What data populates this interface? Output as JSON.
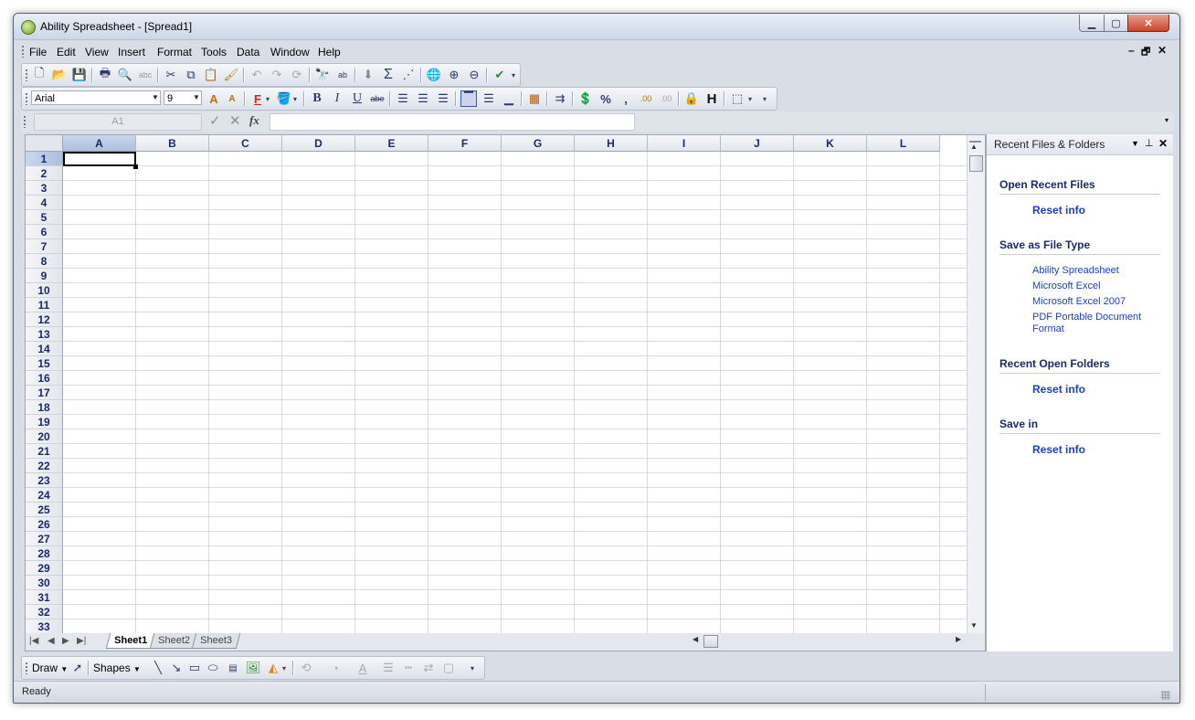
{
  "window": {
    "title": "Ability Spreadsheet - [Spread1]",
    "min_glyph": "▁",
    "max_glyph": "▢",
    "close_glyph": "✕"
  },
  "menubar": {
    "items": [
      "File",
      "Edit",
      "View",
      "Insert",
      "Format",
      "Tools",
      "Data",
      "Window",
      "Help"
    ],
    "mdi_min": "–",
    "mdi_restore": "🗗",
    "mdi_close": "✕"
  },
  "format_toolbar": {
    "font": "Arial",
    "size": "9"
  },
  "formula_bar": {
    "cell_ref": "A1",
    "formula": "",
    "fx_label": "fx"
  },
  "grid": {
    "columns": [
      "A",
      "B",
      "C",
      "D",
      "E",
      "F",
      "G",
      "H",
      "I",
      "J",
      "K",
      "L"
    ],
    "rows": [
      "1",
      "2",
      "3",
      "4",
      "5",
      "6",
      "7",
      "8",
      "9",
      "10",
      "11",
      "12",
      "13",
      "14",
      "15",
      "16",
      "17",
      "18",
      "19",
      "20",
      "21",
      "22",
      "23",
      "24",
      "25",
      "26",
      "27",
      "28",
      "29",
      "30",
      "31",
      "32",
      "33"
    ],
    "active_column": "A",
    "active_row": "1"
  },
  "sheets": {
    "tabs": [
      "Sheet1",
      "Sheet2",
      "Sheet3"
    ],
    "active": "Sheet1"
  },
  "task_pane": {
    "title": "Recent Files & Folders",
    "open_recent_header": "Open Recent Files",
    "open_recent_reset": "Reset info",
    "save_type_header": "Save as File Type",
    "save_types": [
      "Ability Spreadsheet",
      "Microsoft Excel",
      "Microsoft Excel 2007",
      "PDF Portable Document Format"
    ],
    "recent_folders_header": "Recent Open Folders",
    "recent_folders_reset": "Reset info",
    "save_in_header": "Save in",
    "save_in_reset": "Reset info"
  },
  "draw_toolbar": {
    "draw_label": "Draw",
    "shapes_label": "Shapes"
  },
  "status": {
    "text": "Ready"
  },
  "icons": {
    "standard": [
      "new-icon",
      "open-icon",
      "save-icon",
      "print-icon",
      "print-preview-icon",
      "spell-check-icon",
      "cut-icon",
      "copy-icon",
      "paste-icon",
      "format-painter-icon",
      "undo-icon",
      "redo-icon",
      "repeat-icon",
      "find-icon",
      "replace-icon",
      "insert-function-icon",
      "autosum-icon",
      "chart-icon",
      "internet-icon",
      "zoom-in-icon",
      "zoom-out-icon",
      "help-icon"
    ],
    "formatting": [
      "increase-font-icon",
      "decrease-font-icon",
      "font-color-icon",
      "fill-color-icon",
      "bold-icon",
      "italic-icon",
      "underline-icon",
      "strikethrough-icon",
      "align-left-icon",
      "align-center-icon",
      "align-right-icon",
      "align-top-icon",
      "align-middle-icon",
      "align-bottom-icon",
      "grid-icon",
      "merge-icon",
      "currency-icon",
      "percent-icon",
      "comma-icon",
      "increase-decimal-icon",
      "decrease-decimal-icon",
      "lock-icon",
      "hide-icon",
      "borders-icon"
    ]
  },
  "colors": {
    "accent_blue": "#1c3fc0",
    "header_text": "#1a2a6a",
    "font_color": "#e0201a",
    "fill_color": "#f5e000"
  }
}
